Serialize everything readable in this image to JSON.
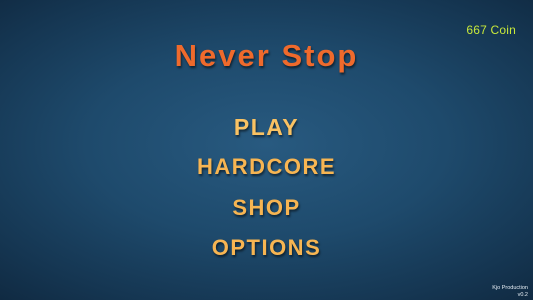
{
  "hud": {
    "coins": "667 Coin"
  },
  "title": "Never Stop",
  "menu": {
    "items": [
      {
        "label": "PLAY"
      },
      {
        "label": "HARDCORE"
      },
      {
        "label": "SHOP"
      },
      {
        "label": "OPTIONS"
      }
    ]
  },
  "footer": {
    "credit": "Kjo Production",
    "version": "v0.2"
  },
  "colors": {
    "background": "#1e4a6c",
    "title": "#ef6a2c",
    "menu_text": "#f7b552",
    "coin_text": "#c8e83a"
  }
}
